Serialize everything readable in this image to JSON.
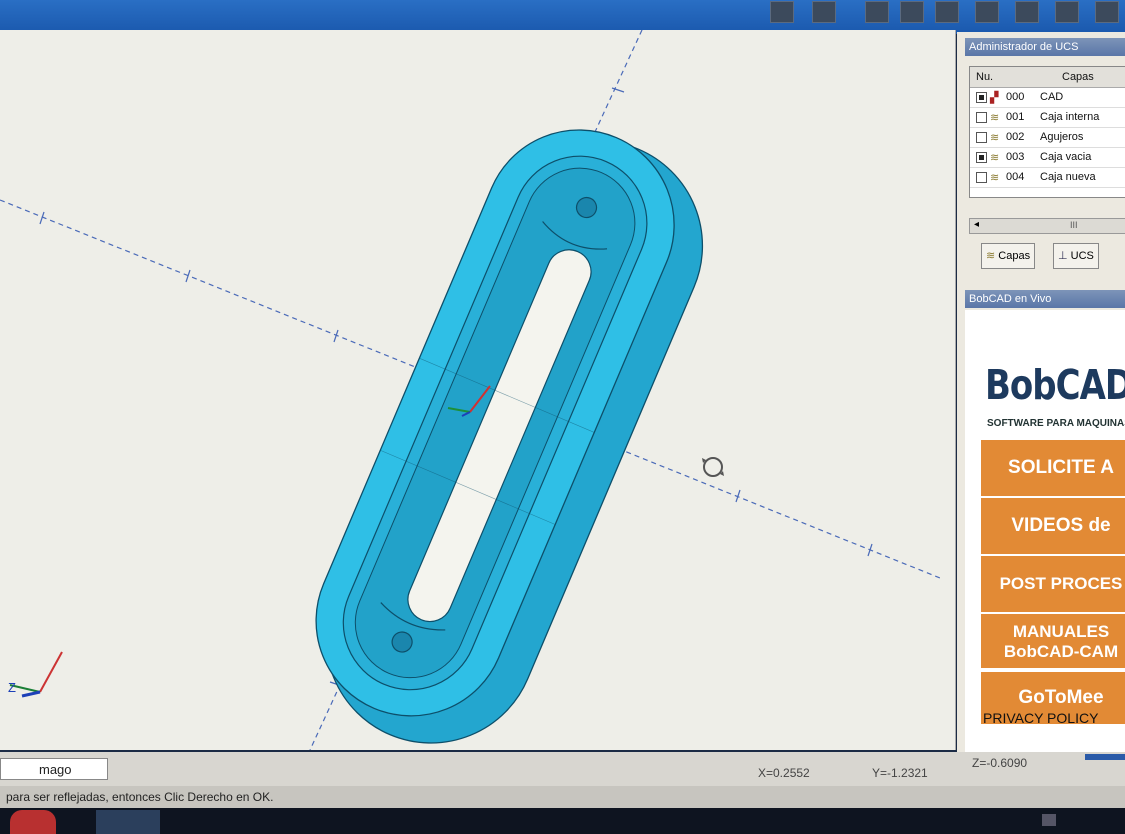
{
  "toolbar": {
    "icon_names": [
      "view-icon",
      "user-icon",
      "solid-icon",
      "pen-icon",
      "lock-icon",
      "layers-icon",
      "cube-icon",
      "gear-icon",
      "render-icon"
    ]
  },
  "ucs_manager": {
    "title": "Administrador de UCS",
    "columns": [
      "Nu.",
      "Capas"
    ],
    "rows": [
      {
        "num": "000",
        "name": "CAD",
        "checked": true
      },
      {
        "num": "001",
        "name": "Caja interna",
        "checked": false
      },
      {
        "num": "002",
        "name": "Agujeros",
        "checked": false
      },
      {
        "num": "003",
        "name": "Caja vacia",
        "checked": true
      },
      {
        "num": "004",
        "name": "Caja nueva",
        "checked": false
      }
    ],
    "scroll_label": "III",
    "tabs": [
      "Capas",
      "UCS"
    ]
  },
  "live_panel": {
    "title": "BobCAD en Vivo",
    "logo": "BobCAD-CAM",
    "subtitle": "SOFTWARE PARA MAQUINAS CNC",
    "buttons": [
      "SOLICITE A",
      "VIDEOS de",
      "POST PROCES",
      "MANUALES BobCAD-CAM",
      "GoToMee"
    ],
    "privacy": "PRIVACY POLICY"
  },
  "status": {
    "input_value": "mago",
    "x": "X=0.2552",
    "y": "Y=-1.2321",
    "z": "Z=-0.6090",
    "message": "para ser reflejadas, entonces Clic Derecho en OK."
  },
  "colors": {
    "model_fill": "#29b6de",
    "model_edge": "#0d4f6a",
    "accent_orange": "#e28a35"
  }
}
